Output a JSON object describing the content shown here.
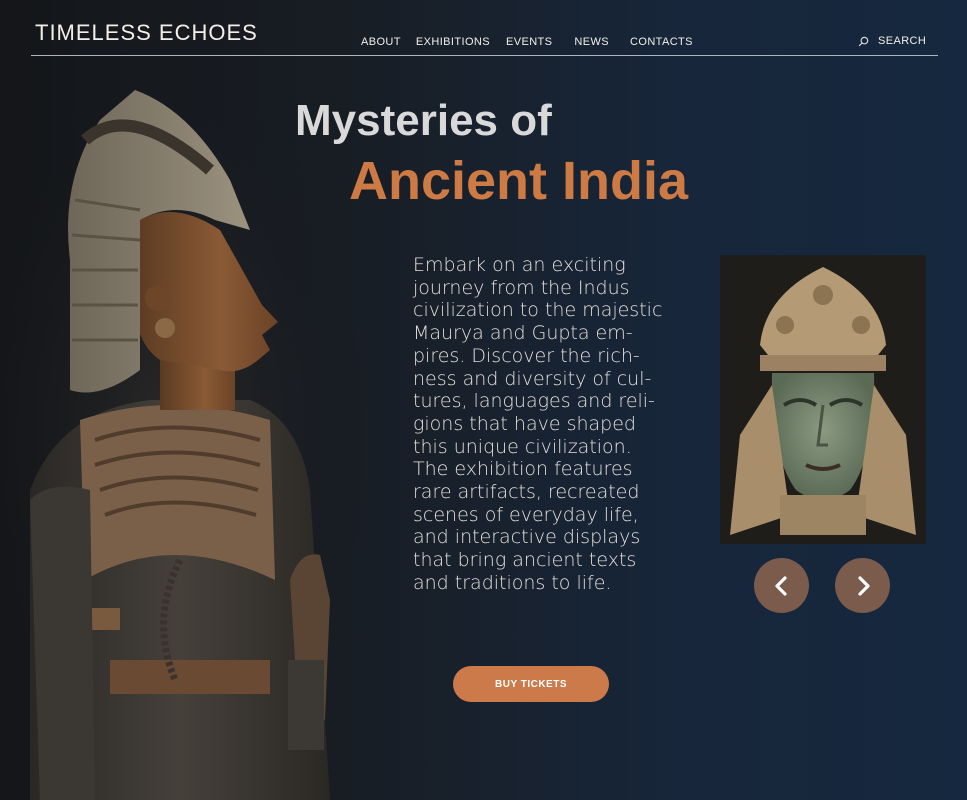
{
  "header": {
    "logo": "TIMELESS ECHOES",
    "nav": [
      "ABOUT",
      "EXHIBITIONS",
      "EVENTS",
      "NEWS",
      "CONTACTS"
    ],
    "search_label": "SEARCH"
  },
  "hero": {
    "title_line1": "Mysteries of",
    "title_line2": "Ancient India",
    "description": "Embark on an exciting journey from the Indus civilization to the majestic Maurya and Gupta em-pires. Discover the rich-ness and diversity of cul-tures, languages and reli-gions that have shaped this unique civilization. The exhibition features rare artifacts, recreated scenes of everyday life, and interactive displays that bring ancient texts and traditions to life.",
    "cta_label": "BUY TICKETS"
  },
  "carousel": {
    "prev_icon": "chevron-left-icon",
    "next_icon": "chevron-right-icon"
  },
  "colors": {
    "accent": "#cd7a45",
    "arrow_bg": "#7a5b4c",
    "background": "#16283f"
  }
}
